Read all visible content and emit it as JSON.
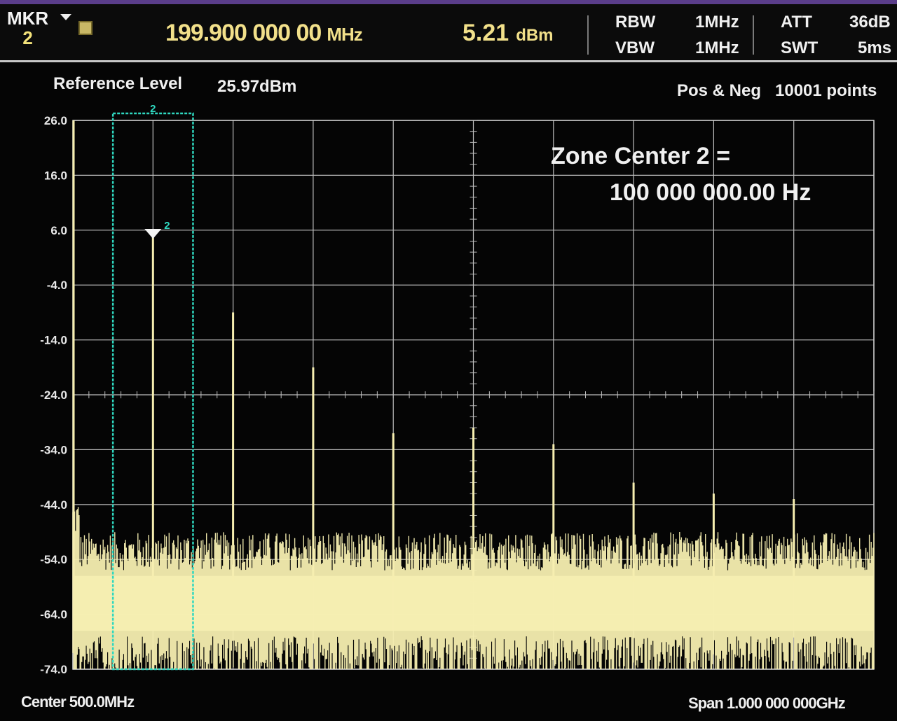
{
  "header": {
    "marker_label": "MKR",
    "marker_number": "2",
    "marker_frequency": "199.900 000 00",
    "marker_frequency_unit": "MHz",
    "marker_amplitude": "5.21",
    "marker_amplitude_unit": "dBm",
    "rbw_label": "RBW",
    "rbw_value": "1MHz",
    "vbw_label": "VBW",
    "vbw_value": "1MHz",
    "att_label": "ATT",
    "att_value": "36dB",
    "swt_label": "SWT",
    "swt_value": "5ms"
  },
  "trace_info": {
    "reference_level_label": "Reference Level",
    "reference_level_value": "25.97dBm",
    "detector": "Pos & Neg",
    "points": "10001  points"
  },
  "footer": {
    "center": "Center 500.0MHz",
    "span": "Span 1.000 000 000GHz"
  },
  "annotation": {
    "line1": "Zone Center 2 =",
    "line2": "100 000 000.00 Hz"
  },
  "colors": {
    "trace": "#f6eeb0",
    "marker_zone": "#2fd8c0",
    "grid": "#bdbdbd",
    "background": "#050505"
  },
  "chart_data": {
    "type": "line",
    "title": "",
    "xlabel": "",
    "ylabel": "",
    "xlim": [
      0,
      1000
    ],
    "x_unit": "MHz",
    "ylim": [
      -74,
      26
    ],
    "y_ticks": [
      "26.0",
      "16.0",
      "6.0",
      "-4.0",
      "-14.0",
      "-24.0",
      "-34.0",
      "-44.0",
      "-54.0",
      "-64.0",
      "-74.0"
    ],
    "noise_floor_dbm": -62,
    "peaks": [
      {
        "x": 0,
        "y": 26
      },
      {
        "x": 100,
        "y": 5.21
      },
      {
        "x": 200,
        "y": -9
      },
      {
        "x": 300,
        "y": -19
      },
      {
        "x": 400,
        "y": -31
      },
      {
        "x": 500,
        "y": -30
      },
      {
        "x": 600,
        "y": -33
      },
      {
        "x": 700,
        "y": -40
      },
      {
        "x": 800,
        "y": -42
      },
      {
        "x": 900,
        "y": -43
      }
    ],
    "marker": {
      "label": "2",
      "x": 100,
      "y": 5.21
    },
    "zone": {
      "label": "2",
      "x_start": 50,
      "x_end": 150
    }
  }
}
